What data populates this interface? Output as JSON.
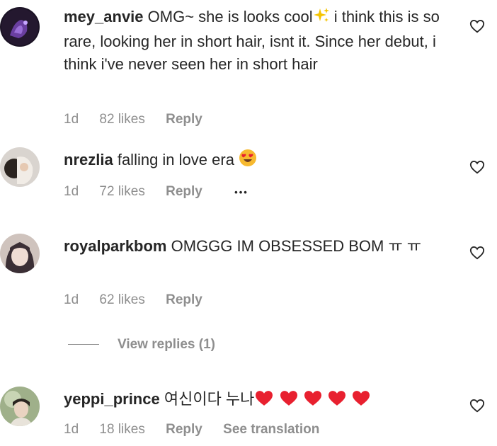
{
  "comments": [
    {
      "username": "mey_anvie",
      "text": "OMG~ she is looks cool",
      "text_after": " i think this is so rare, looking her in short hair, isnt it. Since her debut, i think i've never seen her in short hair",
      "time": "1d",
      "likes": "82 likes",
      "reply": "Reply"
    },
    {
      "username": "nrezlia",
      "text": "falling in love era",
      "time": "1d",
      "likes": "72 likes",
      "reply": "Reply",
      "more": "•••"
    },
    {
      "username": "royalparkbom",
      "text": "OMGGG IM OBSESSED BOM ㅠ ㅠ",
      "time": "1d",
      "likes": "62 likes",
      "reply": "Reply",
      "view_replies": "View replies (1)"
    },
    {
      "username": "yeppi_prince",
      "text": "여신이다 누나",
      "time": "1d",
      "likes": "18 likes",
      "reply": "Reply",
      "see_translation": "See translation"
    }
  ],
  "icons": {
    "sparkle": "sparkles-icon",
    "heart_eyes": "heart-eyes-emoji-icon",
    "red_heart": "red-heart-icon",
    "like": "heart-outline-icon"
  },
  "colors": {
    "text": "#262626",
    "meta": "#8e8e8e",
    "heart_red": "#e8202f",
    "sparkle_yellow": "#f5c400"
  }
}
